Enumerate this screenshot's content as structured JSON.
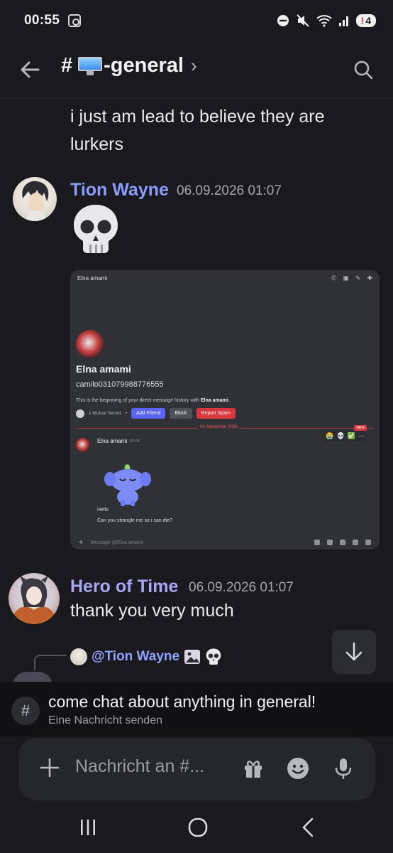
{
  "status_bar": {
    "time": "00:55",
    "notification_count": "4",
    "alert_mark": "!"
  },
  "header": {
    "hash": "#",
    "channel_name": "-general",
    "chevron": "›"
  },
  "messages": {
    "continuation": "i just am lead to believe they are lurkers",
    "tion": {
      "username": "Tion Wayne",
      "timestamp": "06.09.2026 01:07",
      "username_color": "#8b9cff"
    },
    "embed": {
      "top_name": "Elna amami",
      "profile_name": "Elna amami",
      "profile_username": "camilo031079988776555",
      "intro_prefix": "This is the beginning of your direct message history with ",
      "intro_name": "Elna amami",
      "intro_suffix": ".",
      "mutual": "1 Mutual Server",
      "bullet": "•",
      "add_friend": "Add Friend",
      "block": "Block",
      "report_spam": "Report Spam",
      "date_divider": "06 September 2026",
      "new_badge": "NEW",
      "msg_name": "Elna amami",
      "msg_time": "00:01",
      "line1": "Hello",
      "line2": "Can you strangle me so i can die?",
      "input_placeholder": "Message @Elna amami",
      "plus": "+"
    },
    "hero": {
      "username": "Hero of Time",
      "timestamp": "06.09.2026 01:07",
      "text": "thank you very much",
      "username_color": "#a7a6f5"
    },
    "reply": {
      "mention": "@Tion Wayne"
    }
  },
  "topic": {
    "hash": "#",
    "text": "come chat about anything in general!",
    "subtext": "Eine Nachricht senden"
  },
  "composer": {
    "placeholder": "Nachricht an #..."
  },
  "icons": [
    "back-arrow-icon",
    "search-icon",
    "skull-emoji-icon",
    "image-icon",
    "arrow-down-icon",
    "plus-icon",
    "gift-icon",
    "emoji-icon",
    "microphone-icon",
    "recent-apps-icon",
    "home-icon",
    "back-nav-icon"
  ]
}
